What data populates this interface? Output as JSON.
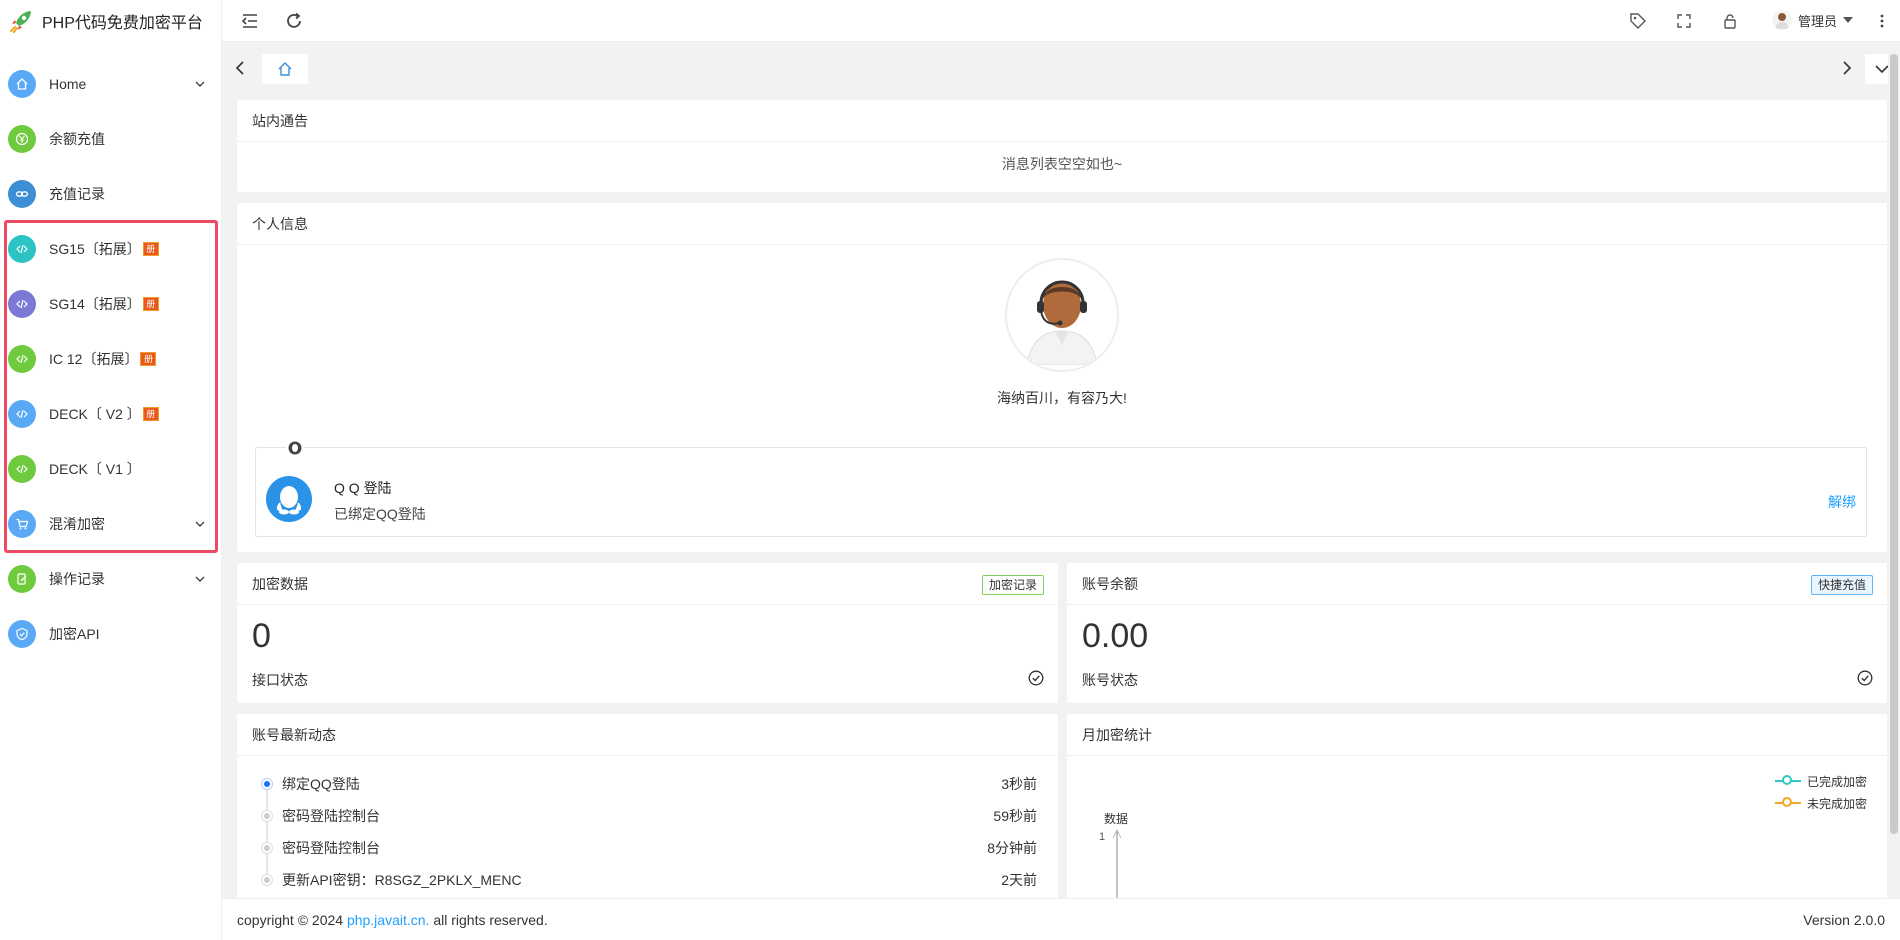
{
  "app": {
    "title": "PHP代码免费加密平台"
  },
  "sidebar": {
    "items": [
      {
        "label": "Home",
        "icon": "home-icon",
        "color": "#5aa9f6",
        "chevron": true,
        "badge": false
      },
      {
        "label": "余额充值",
        "icon": "yen-icon",
        "color": "#6fca3e",
        "chevron": false,
        "badge": false
      },
      {
        "label": "充值记录",
        "icon": "link-icon",
        "color": "#3c8fd4",
        "chevron": false,
        "badge": false
      },
      {
        "label": "SG15〔拓展〕",
        "icon": "code-icon",
        "color": "#2bc3c3",
        "chevron": false,
        "badge": true
      },
      {
        "label": "SG14〔拓展〕",
        "icon": "code-icon",
        "color": "#7b79d6",
        "chevron": false,
        "badge": true
      },
      {
        "label": "IC 12〔拓展〕",
        "icon": "code-icon",
        "color": "#6fca3e",
        "chevron": false,
        "badge": true
      },
      {
        "label": "DECK〔 V2 〕",
        "icon": "code-icon",
        "color": "#5aa9f6",
        "chevron": false,
        "badge": true
      },
      {
        "label": "DECK〔 V1 〕",
        "icon": "code-icon",
        "color": "#6fca3e",
        "chevron": false,
        "badge": false
      },
      {
        "label": "混淆加密",
        "icon": "cart-icon",
        "color": "#5aa9f6",
        "chevron": true,
        "badge": false
      },
      {
        "label": "操作记录",
        "icon": "edit-icon",
        "color": "#6fca3e",
        "chevron": true,
        "badge": false
      },
      {
        "label": "加密API",
        "icon": "shield-icon",
        "color": "#5aa9f6",
        "chevron": false,
        "badge": false
      }
    ],
    "badge_glyph": "册"
  },
  "header": {
    "user_name": "管理员"
  },
  "notice": {
    "title": "站内通告",
    "empty_text": "消息列表空空如也~"
  },
  "profile": {
    "title": "个人信息",
    "motto": "海纳百川，有容乃大!",
    "qq_title": "Q Q 登陆",
    "qq_status": "已绑定QQ登陆",
    "qq_unbind": "解绑"
  },
  "encrypt_stats": {
    "title": "加密数据",
    "tag": "加密记录",
    "value": "0",
    "label": "接口状态"
  },
  "balance": {
    "title": "账号余额",
    "tag": "快捷充值",
    "value": "0.00",
    "label": "账号状态"
  },
  "activity": {
    "title": "账号最新动态",
    "items": [
      {
        "text": "绑定QQ登陆",
        "time": "3秒前"
      },
      {
        "text": "密码登陆控制台",
        "time": "59秒前"
      },
      {
        "text": "密码登陆控制台",
        "time": "8分钟前"
      },
      {
        "text": "更新API密钥：R8SGZ_2PKLX_MENC",
        "time": "2天前"
      }
    ]
  },
  "monthly": {
    "title": "月加密统计",
    "legend": [
      {
        "name": "已完成加密",
        "color": "#2ec7c9"
      },
      {
        "name": "未完成加密",
        "color": "#f5a623"
      }
    ],
    "y_label": "数据",
    "y_tick": "1"
  },
  "footer": {
    "copyright_prefix": "copyright © 2024",
    "link_text": "php.javait.cn.",
    "copyright_suffix": "all rights reserved.",
    "version": "Version 2.0.0"
  }
}
